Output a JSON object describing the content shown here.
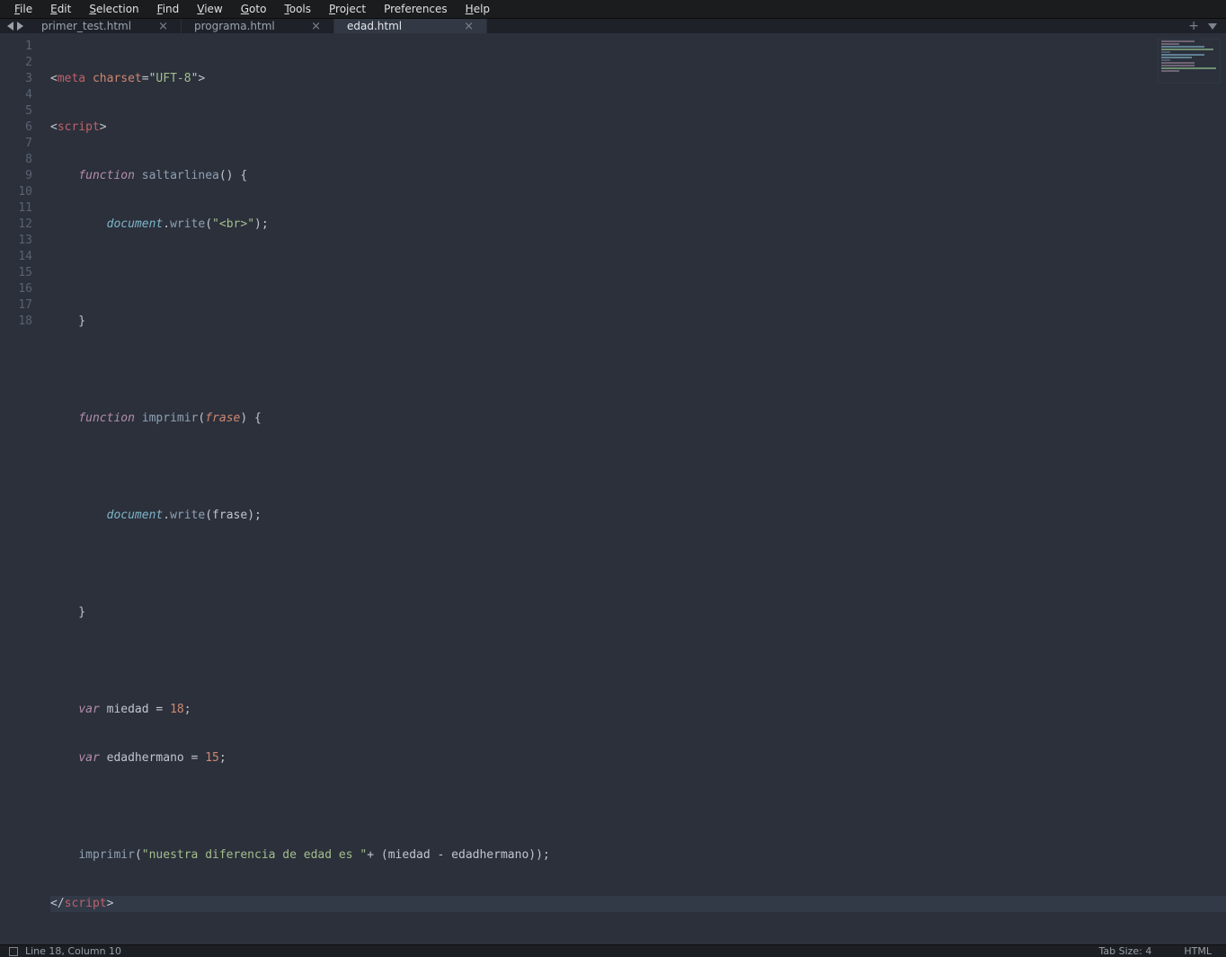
{
  "menu": {
    "file": "File",
    "edit": "Edit",
    "selection": "Selection",
    "find": "Find",
    "view": "View",
    "goto": "Goto",
    "tools": "Tools",
    "project": "Project",
    "preferences": "Preferences",
    "help": "Help"
  },
  "tabs": [
    {
      "label": "primer_test.html",
      "active": false
    },
    {
      "label": "programa.html",
      "active": false
    },
    {
      "label": "edad.html",
      "active": true
    }
  ],
  "code": {
    "l1": {
      "p1": "<",
      "tag": "meta",
      "sp": " ",
      "attr": "charset",
      "eq": "=",
      "q1": "\"",
      "str": "UFT-8",
      "q2": "\"",
      "p2": ">"
    },
    "l2": {
      "p1": "<",
      "tag": "script",
      "p2": ">"
    },
    "l3": {
      "kw": "function",
      "sp": " ",
      "fn": "saltarlinea",
      "rest": "() {"
    },
    "l4": {
      "obj": "document",
      "dot": ".",
      "fn": "write",
      "op": "(",
      "q1": "\"",
      "str": "<br>",
      "q2": "\"",
      "cl": ");"
    },
    "l5": "",
    "l6": "    }",
    "l7": "",
    "l8": {
      "kw": "function",
      "sp": " ",
      "fn": "imprimir",
      "op": "(",
      "par": "frase",
      "cl": ") {"
    },
    "l9": "",
    "l10": {
      "obj": "document",
      "dot": ".",
      "fn": "write",
      "op": "(",
      "id": "frase",
      "cl": ");"
    },
    "l11": "",
    "l12": "    }",
    "l13": "",
    "l14": {
      "kw": "var",
      "sp": " ",
      "id": "miedad",
      "eq": " = ",
      "num": "18",
      "sc": ";"
    },
    "l15": {
      "kw": "var",
      "sp": " ",
      "id": "edadhermano",
      "eq": " = ",
      "num": "15",
      "sc": ";"
    },
    "l16": "",
    "l17": {
      "fn": "imprimir",
      "op": "(",
      "q1": "\"",
      "str": "nuestra diferencia de edad es ",
      "q2": "\"",
      "plus": "+ (",
      "id1": "miedad",
      "minus": " - ",
      "id2": "edadhermano",
      "cl": "));"
    },
    "l18": {
      "p1": "</",
      "tag": "script",
      "p2": ">"
    }
  },
  "linecount": 18,
  "status": {
    "position": "Line 18, Column 10",
    "tabsize": "Tab Size: 4",
    "syntax": "HTML"
  },
  "close_glyph": "×",
  "plus_glyph": "+"
}
